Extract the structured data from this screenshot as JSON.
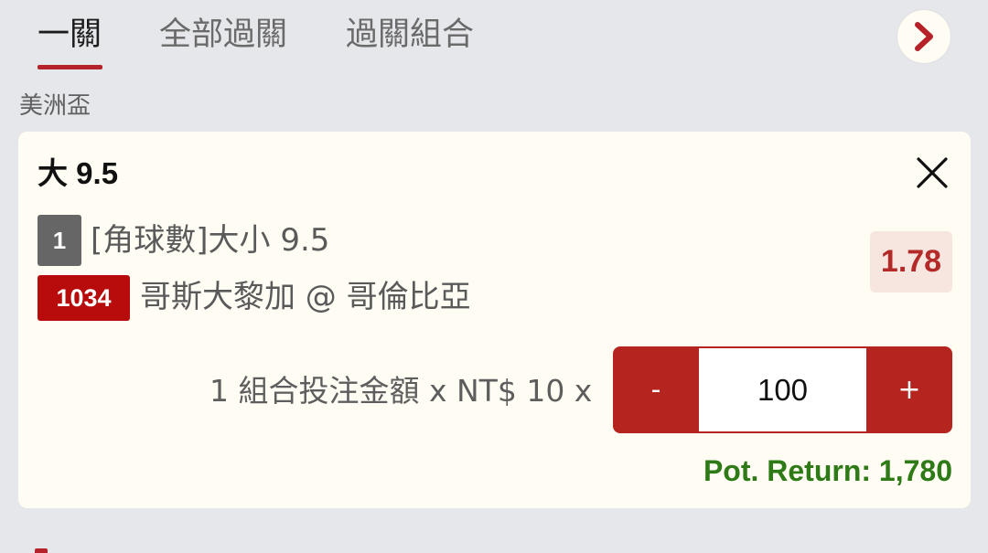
{
  "tabs": [
    {
      "label": "一關",
      "active": true
    },
    {
      "label": "全部過關",
      "active": false
    },
    {
      "label": "過關組合",
      "active": false
    }
  ],
  "next_icon": "chevron-right-icon",
  "competition": "美洲盃",
  "bet": {
    "selection": "大 9.5",
    "market_number": "1",
    "market": "[角球數]大小 9.5",
    "match_number": "1034",
    "match": "哥斯大黎加 @ 哥倫比亞",
    "odds": "1.78",
    "stake_label": "1 組合投注金額 x NT$ 10 x",
    "stepper": {
      "minus": "-",
      "plus": "+",
      "value": "100"
    },
    "pot_return": "Pot. Return: 1,780"
  },
  "colors": {
    "accent": "#b5222a",
    "odds_bg": "#f6e6df",
    "odds_text": "#b32a28",
    "return_text": "#2d7a16",
    "card_bg": "#fffdf3",
    "page_bg": "#e6e7ea"
  }
}
